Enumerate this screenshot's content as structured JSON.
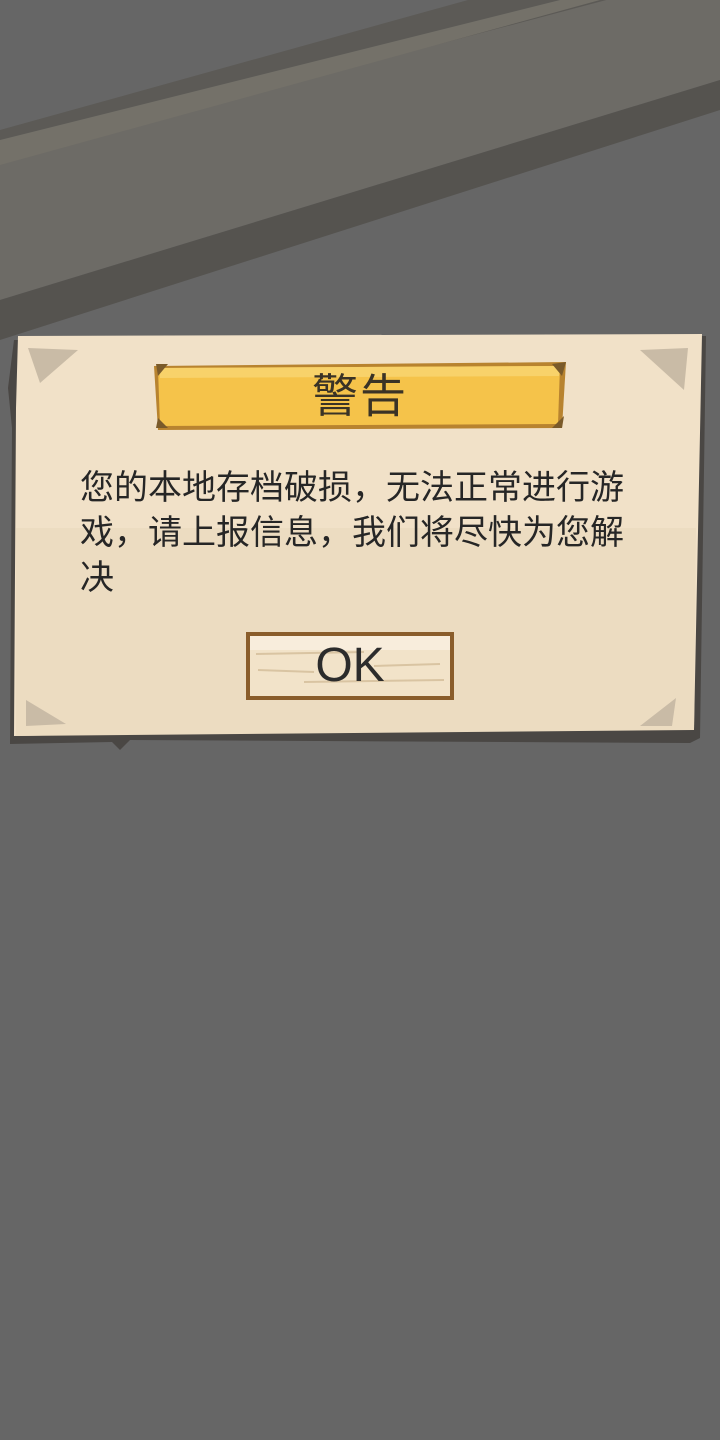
{
  "dialog": {
    "title": "警告",
    "message": "您的本地存档破损，无法正常进行游戏，请上报信息，我们将尽快为您解决",
    "ok_label": "OK"
  },
  "colors": {
    "backdrop": "#666666",
    "paper": "#f1e1c8",
    "banner": "#f5c34a",
    "button_wood": "#f2e3c9"
  }
}
